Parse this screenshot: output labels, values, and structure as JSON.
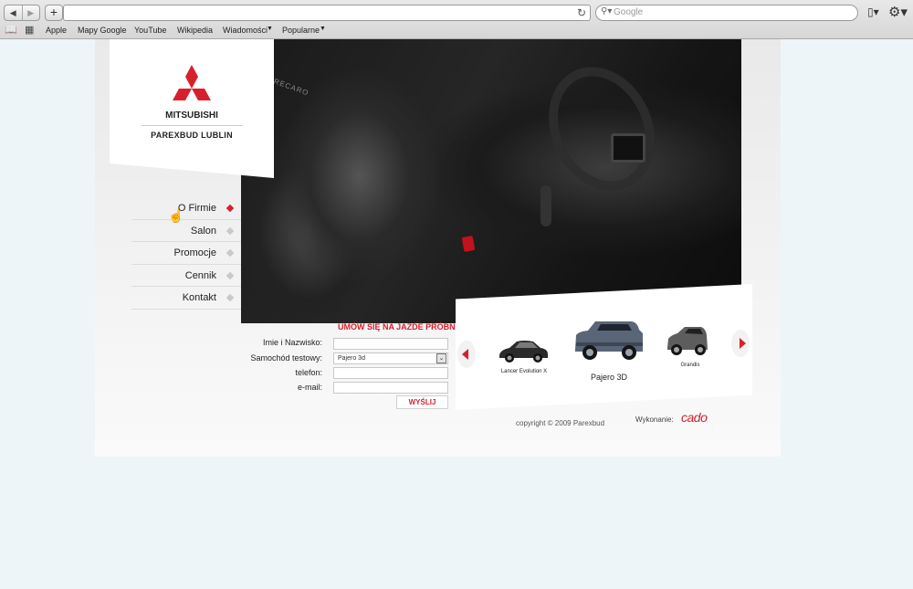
{
  "browser": {
    "search_placeholder": "Google",
    "bookmarks": [
      "Apple",
      "Mapy Google",
      "YouTube",
      "Wikipedia",
      "Wiadomości",
      "Popularne"
    ],
    "icons": [
      "back-icon",
      "forward-icon",
      "add-icon",
      "reload-icon",
      "search-icon",
      "page-icon",
      "gear-icon",
      "bookmarks-book-icon",
      "top-sites-grid-icon"
    ]
  },
  "site": {
    "brand": "MITSUBISHI",
    "dealer": "PAREXBUD LUBLIN",
    "nav": [
      "O Firmie",
      "Salon",
      "Promocje",
      "Cennik",
      "Kontakt"
    ],
    "accent_color": "#d8202c",
    "form": {
      "title": "UMÓW SIĘ NA JAZDE PRÓBNĄ",
      "name_label": "Imie i Nazwisko:",
      "car_label": "Samochód testowy:",
      "car_value": "Pajero 3d",
      "phone_label": "telefon:",
      "email_label": "e-mail:",
      "submit": "WYŚLIJ"
    },
    "cars": [
      {
        "name": "Lancer Evolution X"
      },
      {
        "name": "Pajero 3D"
      },
      {
        "name": "Grandis"
      }
    ],
    "footer": {
      "copyright": "copyright © 2009 Parexbud",
      "made_by_label": "Wykonanie:",
      "made_by": "cado"
    }
  }
}
